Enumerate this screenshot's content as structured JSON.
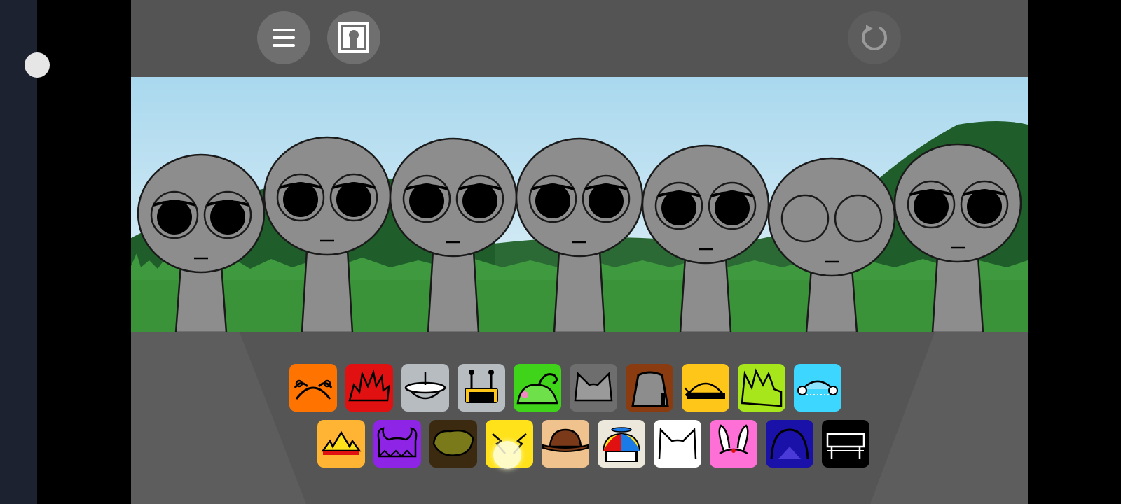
{
  "toolbar": {
    "menu_icon": "hamburger-menu-icon",
    "gallery_icon": "portrait-frame-icon",
    "reset_icon": "reset-arrow-icon"
  },
  "stage": {
    "background": {
      "sky_top": "#a9d8ee",
      "sky_bottom": "#dff0f7",
      "hill_dark": "#1f5d2a",
      "grass": "#3f9a3f"
    },
    "character_count": 7,
    "characters": [
      {
        "id": 1,
        "eyes": "open"
      },
      {
        "id": 2,
        "eyes": "open"
      },
      {
        "id": 3,
        "eyes": "open"
      },
      {
        "id": 4,
        "eyes": "open"
      },
      {
        "id": 5,
        "eyes": "open"
      },
      {
        "id": 6,
        "eyes": "closed"
      },
      {
        "id": 7,
        "eyes": "open"
      }
    ]
  },
  "palette": {
    "row_1": [
      {
        "name": "orange-antenna-sound",
        "color": "#ff7300"
      },
      {
        "name": "red-spiky-hair-sound",
        "color": "#e21111"
      },
      {
        "name": "silver-halo-sound",
        "color": "#b7bcc0"
      },
      {
        "name": "silver-antenna-visor-sound",
        "color": "#b7bcc0"
      },
      {
        "name": "green-swirl-sound",
        "color": "#3fd41a"
      },
      {
        "name": "gray-cat-ears-sound",
        "color": "#6e6e6e"
      },
      {
        "name": "brown-top-hat-sound",
        "color": "#8a3c10"
      },
      {
        "name": "yellow-helmet-sound",
        "color": "#ffc61a"
      },
      {
        "name": "lime-spiky-sound",
        "color": "#a6e61a"
      },
      {
        "name": "cyan-headphones-sound",
        "color": "#3cd6ff"
      }
    ],
    "row_2": [
      {
        "name": "orange-crown-sound",
        "color": "#ffb533"
      },
      {
        "name": "purple-horns-sound",
        "color": "#8e24e6"
      },
      {
        "name": "brown-blob-sound",
        "color": "#3b2a0f"
      },
      {
        "name": "yellow-lightning-sound",
        "color": "#ffe21a"
      },
      {
        "name": "tan-cowboy-hat-sound",
        "color": "#efc28e"
      },
      {
        "name": "propeller-cap-sound",
        "color": "#ede8dc"
      },
      {
        "name": "white-cat-sound",
        "color": "#ffffff"
      },
      {
        "name": "pink-bunny-ears-sound",
        "color": "#ff70d7"
      },
      {
        "name": "navy-dome-sound",
        "color": "#1a12a8"
      },
      {
        "name": "black-bench-sound",
        "color": "#000000"
      }
    ]
  },
  "colors": {
    "frame": "#545454",
    "character_fill": "#8d8d8d",
    "character_stroke": "#1a1a1a"
  }
}
